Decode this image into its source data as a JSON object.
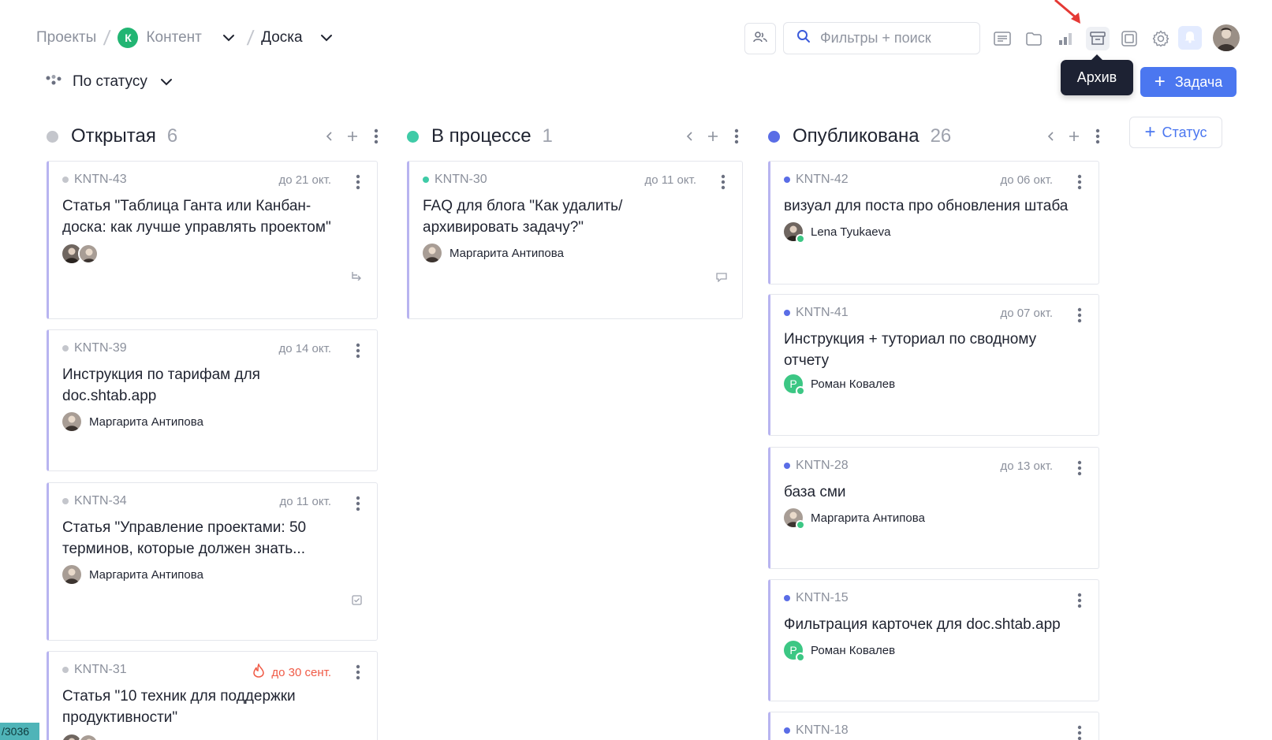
{
  "breadcrumb": {
    "projects": "Проекты",
    "project_badge": "К",
    "project_name": "Контент",
    "view": "Доска"
  },
  "toolbar": {
    "search_placeholder": "Фильтры + поиск",
    "tooltip": "Архив",
    "add_task_label": "Задача",
    "add_status_label": "Статус"
  },
  "grouping": {
    "label": "По статусу"
  },
  "icons": {
    "members": "members-icon",
    "search": "search-icon",
    "list": "list-view-icon",
    "folder": "folder-icon",
    "stats": "bar-chart-icon",
    "archive": "archive-icon",
    "layout": "layout-icon",
    "settings": "gear-icon",
    "bell": "bell-icon"
  },
  "colors": {
    "accent": "#4b77f0",
    "open": "#c4c6cc",
    "progress": "#3fcba7",
    "published": "#5a6de6",
    "overdue": "#f05a46",
    "card_border": "#b8b4f0"
  },
  "columns": [
    {
      "title": "Открытая",
      "count": "6",
      "cards": [
        {
          "key": "KNTN-43",
          "due": "до 21 окт.",
          "title_lines": [
            "Статья \"Таблица Ганта или Канбан-",
            "доска: как лучше управлять проектом\""
          ],
          "assignee": "",
          "icon": "subtask-icon"
        },
        {
          "key": "KNTN-39",
          "due": "до 14 окт.",
          "title_lines": [
            "Инструкция по тарифам для",
            "doc.shtab.app"
          ],
          "assignee": "Маргарита Антипова",
          "icon": ""
        },
        {
          "key": "KNTN-34",
          "due": "до 11 окт.",
          "title_lines": [
            "Статья \"Управление проектами: 50",
            "терминов, которые должен знать..."
          ],
          "assignee": "Маргарита Антипова",
          "icon": "checklist-icon"
        },
        {
          "key": "KNTN-31",
          "due": "до 30 сент.",
          "title_lines": [
            "Статья \"10 техник для поддержки",
            "продуктивности\""
          ],
          "assignee": "",
          "icon": ""
        }
      ]
    },
    {
      "title": "В процессе",
      "count": "1",
      "cards": [
        {
          "key": "KNTN-30",
          "due": "до 11 окт.",
          "title_lines": [
            "FAQ для блога \"Как удалить/",
            "архивировать задачу?\""
          ],
          "assignee": "Маргарита Антипова",
          "icon": "comment-icon"
        }
      ]
    },
    {
      "title": "Опубликована",
      "count": "26",
      "cards": [
        {
          "key": "KNTN-42",
          "due": "до 06 окт.",
          "title_lines": [
            "визуал для поста про обновления штаба"
          ],
          "assignee": "Lena Tyukaeva",
          "icon": ""
        },
        {
          "key": "KNTN-41",
          "due": "до 07 окт.",
          "title_lines": [
            "Инструкция + туториал по сводному",
            "отчету"
          ],
          "assignee": "Роман Ковалев",
          "assignee_letter": "Р",
          "icon": ""
        },
        {
          "key": "KNTN-28",
          "due": "до 13 окт.",
          "title_lines": [
            "база сми"
          ],
          "assignee": "Маргарита Антипова",
          "icon": ""
        },
        {
          "key": "KNTN-15",
          "due": "",
          "title_lines": [
            "Фильтрация карточек для doc.shtab.app"
          ],
          "assignee": "Роман Ковалев",
          "assignee_letter": "Р",
          "icon": ""
        },
        {
          "key": "KNTN-18",
          "due": "",
          "title_lines": [],
          "assignee": "",
          "icon": ""
        }
      ]
    }
  ],
  "page_indicator": "/3036"
}
